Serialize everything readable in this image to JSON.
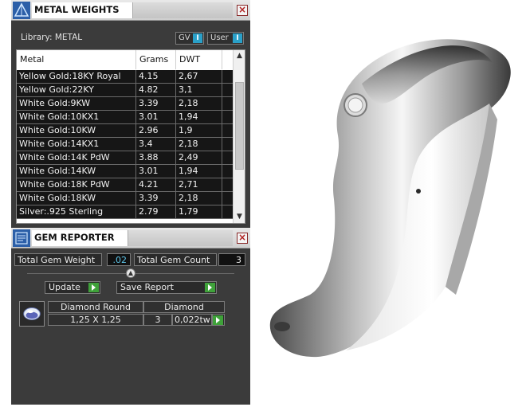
{
  "metal_weights": {
    "title": "METAL WEIGHTS",
    "library_label": "Library: METAL",
    "toggles": [
      {
        "label": "GV",
        "state": "I"
      },
      {
        "label": "User",
        "state": "I"
      }
    ],
    "columns": [
      "Metal",
      "Grams",
      "DWT"
    ],
    "rows": [
      {
        "metal": "Yellow Gold:18KY Royal",
        "grams": "4.15",
        "dwt": "2,67"
      },
      {
        "metal": "Yellow Gold:22KY",
        "grams": "4.82",
        "dwt": "3,1"
      },
      {
        "metal": "White Gold:9KW",
        "grams": "3.39",
        "dwt": "2,18"
      },
      {
        "metal": "White Gold:10KX1",
        "grams": "3.01",
        "dwt": "1,94"
      },
      {
        "metal": "White Gold:10KW",
        "grams": "2.96",
        "dwt": "1,9"
      },
      {
        "metal": "White Gold:14KX1",
        "grams": "3.4",
        "dwt": "2,18"
      },
      {
        "metal": "White Gold:14K PdW",
        "grams": "3.88",
        "dwt": "2,49"
      },
      {
        "metal": "White Gold:14KW",
        "grams": "3.01",
        "dwt": "1,94"
      },
      {
        "metal": "White Gold:18K PdW",
        "grams": "4.21",
        "dwt": "2,71"
      },
      {
        "metal": "White Gold:18KW",
        "grams": "3.39",
        "dwt": "2,18"
      },
      {
        "metal": "Silver:.925 Sterling",
        "grams": "2.79",
        "dwt": "1,79"
      }
    ]
  },
  "gem_reporter": {
    "title": "GEM REPORTER",
    "total_gem_weight_label": "Total Gem Weight",
    "total_gem_weight_value": ".02",
    "total_gem_count_label": "Total Gem Count",
    "total_gem_count_value": "3",
    "update_label": "Update",
    "save_report_label": "Save Report",
    "gem": {
      "shape": "Diamond Round",
      "material": "Diamond",
      "size": "1,25 X 1,25",
      "count": "3",
      "weight": "0,022tw"
    }
  },
  "icons": {
    "metal_weights": "pyramid-icon",
    "gem_reporter": "report-icon",
    "close": "close-icon",
    "play": "play-icon",
    "gem": "diamond-round-icon"
  },
  "colors": {
    "panel_bg": "#3b3b3b",
    "accent_blue": "#5ec6ea",
    "play_green": "#3fa23a",
    "close_red": "#b01f1f"
  }
}
